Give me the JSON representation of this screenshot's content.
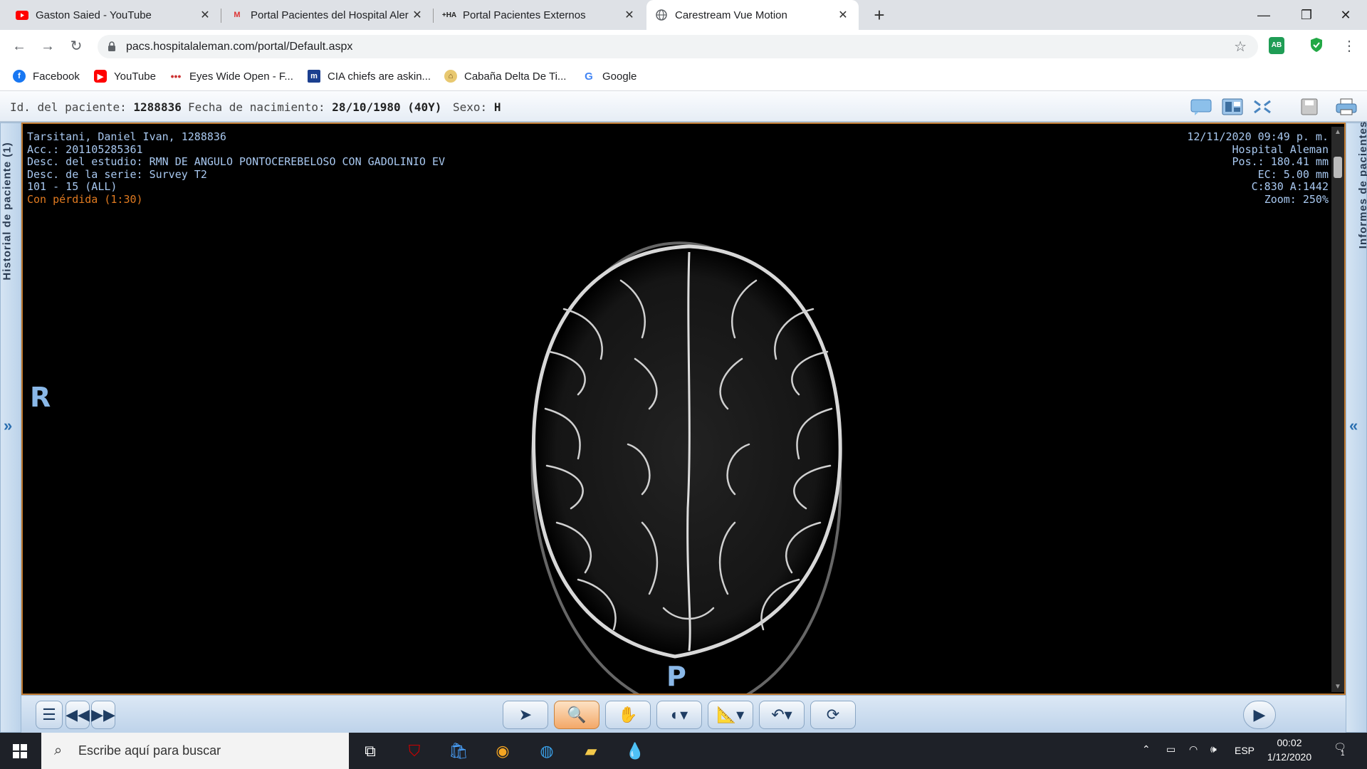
{
  "browser": {
    "tabs": [
      {
        "title": "Gaston Saied - YouTube",
        "icon": "youtube-icon",
        "active": false
      },
      {
        "title": "Portal Pacientes del Hospital Aler",
        "icon": "gmail-icon",
        "active": false
      },
      {
        "title": "Portal Pacientes Externos",
        "icon": "ha-logo-icon",
        "active": false
      },
      {
        "title": "Carestream Vue Motion",
        "icon": "globe-icon",
        "active": true
      }
    ],
    "url": "pacs.hospitalaleman.com/portal/Default.aspx",
    "bookmarks": [
      {
        "label": "Facebook",
        "icon": "facebook-icon"
      },
      {
        "label": "YouTube",
        "icon": "youtube-icon"
      },
      {
        "label": "Eyes Wide Open - F...",
        "icon": "dots-icon"
      },
      {
        "label": "CIA chiefs are askin...",
        "icon": "m-logo-icon"
      },
      {
        "label": "Cabaña Delta De Ti...",
        "icon": "cabana-icon"
      },
      {
        "label": "Google",
        "icon": "google-icon"
      }
    ],
    "ext_badge": "AB"
  },
  "patient": {
    "id_label": "Id. del paciente:",
    "id_value": "1288836",
    "dob_label": "Fecha de nacimiento:",
    "dob_value": "28/10/1980 (40Y)",
    "sex_label": "Sexo:",
    "sex_value": "H"
  },
  "side": {
    "left_label": "Historial de paciente (1)",
    "right_label": "Informes de pacientes",
    "left_arrow": "»",
    "right_arrow": "«"
  },
  "viewer": {
    "top_left": [
      "Tarsitani, Daniel Ivan, 1288836",
      "Acc.: 201105285361",
      "Desc. del estudio: RMN DE ANGULO PONTOCEREBELOSO CON GADOLINIO EV",
      "Desc. de la serie: Survey T2",
      "101 - 15 (ALL)"
    ],
    "compression": "Con pérdida (1:30)",
    "top_right": [
      "12/11/2020 09:49 p. m.",
      "Hospital Aleman",
      "Pos.: 180.41 mm",
      "EC: 5.00 mm",
      "C:830 A:1442",
      "Zoom: 250%"
    ],
    "orient_left": "R",
    "orient_bottom": "P"
  },
  "colors": {
    "accent": "#c07b32",
    "overlay_text": "#a8c8f0",
    "loss_text": "#e07a20"
  },
  "taskbar": {
    "search_placeholder": "Escribe aquí para buscar",
    "lang": "ESP",
    "time": "00:02",
    "date": "1/12/2020",
    "notif_count": "1"
  }
}
